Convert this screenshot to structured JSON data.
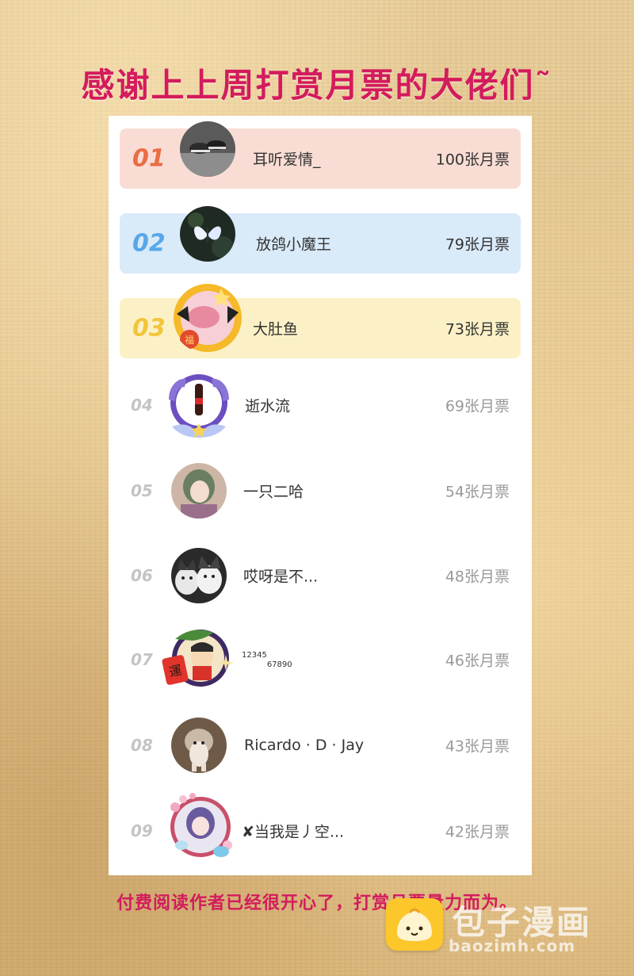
{
  "title": "感谢上上周打赏月票的大佬们˜",
  "ranking": [
    {
      "rank": "01",
      "name": "耳听爱情_",
      "votes": "100张月票",
      "avatar": "sneakers-photo-avatar"
    },
    {
      "rank": "02",
      "name": "放鸽小魔王",
      "votes": "79张月票",
      "avatar": "butterfly-avatar"
    },
    {
      "rank": "03",
      "name": "大肚鱼",
      "votes": "73张月票",
      "avatar": "lucky-badge-avatar"
    },
    {
      "rank": "04",
      "name": "逝水流",
      "votes": "69张月票",
      "avatar": "cola-badge-avatar"
    },
    {
      "rank": "05",
      "name": "一只二哈",
      "votes": "54张月票",
      "avatar": "anime-girl-avatar"
    },
    {
      "rank": "06",
      "name": "哎呀是不...",
      "votes": "48张月票",
      "avatar": "husky-dogs-avatar"
    },
    {
      "rank": "07",
      "name_sup": "12345",
      "name_sub": "67890",
      "votes": "46张月票",
      "avatar": "fortune-cartoon-avatar"
    },
    {
      "rank": "08",
      "name": "Ricardo · D · Jay",
      "votes": "43张月票",
      "avatar": "hedgehog-avatar"
    },
    {
      "rank": "09",
      "name": "✘当我是丿空...",
      "votes": "42张月票",
      "avatar": "sakura-anime-avatar"
    }
  ],
  "footer": "付费阅读作者已经很开心了，打赏月票量力而为。",
  "watermark": {
    "brand": "包子漫画",
    "url": "baozimh.com"
  }
}
